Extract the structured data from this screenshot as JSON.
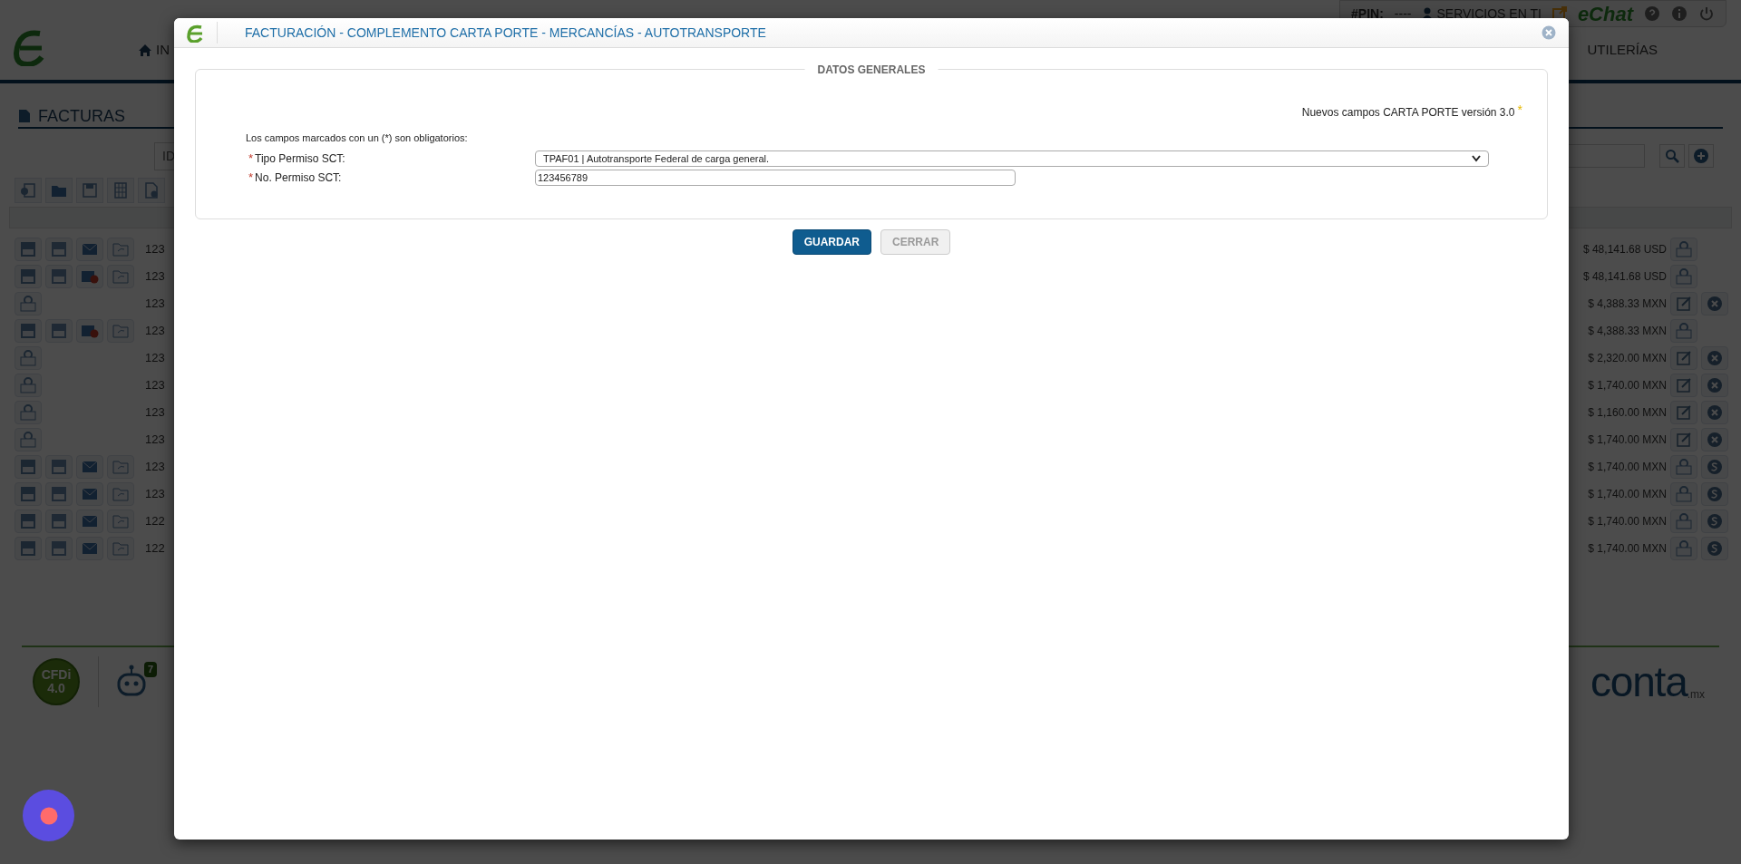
{
  "top_bar": {
    "pin_label": "#PIN:",
    "pin_value": "----",
    "services": "SERVICIOS EN TI",
    "chat_logo": "eChat"
  },
  "nav": [
    {
      "label": "IN"
    },
    {
      "label": "UTILERÍAS"
    }
  ],
  "section_title": "FACTURAS",
  "search": {
    "column_1": "ID"
  },
  "rows": [
    {
      "docs": [
        {
          "kind": "pdf"
        },
        {
          "kind": "xml"
        },
        {
          "kind": "mail"
        },
        {
          "kind": "folder"
        }
      ],
      "id": "123",
      "amount": "$ 48,141.68 USD",
      "actions": [
        {
          "kind": "cfdi"
        }
      ]
    },
    {
      "docs": [
        {
          "kind": "pdf"
        },
        {
          "kind": "xml"
        },
        {
          "kind": "mail_error"
        },
        {
          "kind": "folder"
        }
      ],
      "id": "123",
      "amount": "$ 48,141.68 USD",
      "actions": [
        {
          "kind": "cfdi"
        }
      ]
    },
    {
      "docs": [
        {
          "kind": "cfdi"
        }
      ],
      "id": "123",
      "amount": "$ 4,388.33 MXN",
      "actions": [
        {
          "kind": "edit"
        },
        {
          "kind": "cancel"
        }
      ]
    },
    {
      "docs": [
        {
          "kind": "pdf"
        },
        {
          "kind": "xml"
        },
        {
          "kind": "mail_error"
        },
        {
          "kind": "folder"
        }
      ],
      "id": "123",
      "amount": "$ 4,388.33 MXN",
      "actions": [
        {
          "kind": "cfdi"
        }
      ]
    },
    {
      "docs": [
        {
          "kind": "cfdi"
        }
      ],
      "id": "123",
      "amount": "$ 2,320.00 MXN",
      "actions": [
        {
          "kind": "edit"
        },
        {
          "kind": "cancel"
        }
      ]
    },
    {
      "docs": [
        {
          "kind": "cfdi"
        }
      ],
      "id": "123",
      "amount": "$ 1,740.00 MXN",
      "actions": [
        {
          "kind": "edit"
        },
        {
          "kind": "cancel"
        }
      ]
    },
    {
      "docs": [
        {
          "kind": "cfdi"
        }
      ],
      "id": "123",
      "amount": "$ 1,160.00 MXN",
      "actions": [
        {
          "kind": "edit"
        },
        {
          "kind": "cancel"
        }
      ]
    },
    {
      "docs": [
        {
          "kind": "cfdi"
        }
      ],
      "id": "123",
      "amount": "$ 1,740.00 MXN",
      "actions": [
        {
          "kind": "edit"
        },
        {
          "kind": "cancel"
        }
      ]
    },
    {
      "docs": [
        {
          "kind": "pdf"
        },
        {
          "kind": "xml"
        },
        {
          "kind": "mail"
        },
        {
          "kind": "folder"
        }
      ],
      "id": "123",
      "amount": "$ 1,740.00 MXN",
      "actions": [
        {
          "kind": "cfdi"
        },
        {
          "kind": "pay"
        }
      ]
    },
    {
      "docs": [
        {
          "kind": "pdf"
        },
        {
          "kind": "xml"
        },
        {
          "kind": "mail"
        },
        {
          "kind": "folder"
        }
      ],
      "id": "123",
      "amount": "$ 1,740.00 MXN",
      "actions": [
        {
          "kind": "cfdi"
        },
        {
          "kind": "pay"
        }
      ]
    },
    {
      "docs": [
        {
          "kind": "pdf"
        },
        {
          "kind": "xml"
        },
        {
          "kind": "mail"
        },
        {
          "kind": "folder"
        }
      ],
      "id": "122",
      "amount": "$ 1,740.00 MXN",
      "actions": [
        {
          "kind": "cfdi"
        },
        {
          "kind": "pay"
        }
      ]
    },
    {
      "docs": [
        {
          "kind": "pdf"
        },
        {
          "kind": "xml"
        },
        {
          "kind": "mail"
        },
        {
          "kind": "folder"
        }
      ],
      "id": "122",
      "amount": "$ 1,740.00 MXN",
      "actions": [
        {
          "kind": "cfdi"
        },
        {
          "kind": "pay"
        }
      ]
    }
  ],
  "footer": {
    "cfdi_badge": "CFDi 4.0",
    "bot_badge": "7",
    "logo": "conta",
    "logo_suffix": ".mx"
  },
  "modal": {
    "title": "FACTURACIÓN - COMPLEMENTO CARTA PORTE - MERCANCÍAS - AUTOTRANSPORTE",
    "legend": "DATOS GENERALES",
    "notice": "Nuevos campos CARTA PORTE versión 3.0",
    "notice_mark": "*",
    "required_note": "Los campos marcados con un (*) son obligatorios:",
    "fields": [
      {
        "kind": "select",
        "required_mark": "*",
        "label": "Tipo Permiso SCT:",
        "value": "TPAF01 | Autotransporte Federal de carga general."
      },
      {
        "kind": "text",
        "required_mark": "*",
        "label": "No. Permiso SCT:",
        "value": "123456789"
      }
    ],
    "buttons": [
      {
        "label": "GUARDAR",
        "disabled": false
      },
      {
        "label": "CERRAR",
        "disabled": true
      }
    ]
  }
}
